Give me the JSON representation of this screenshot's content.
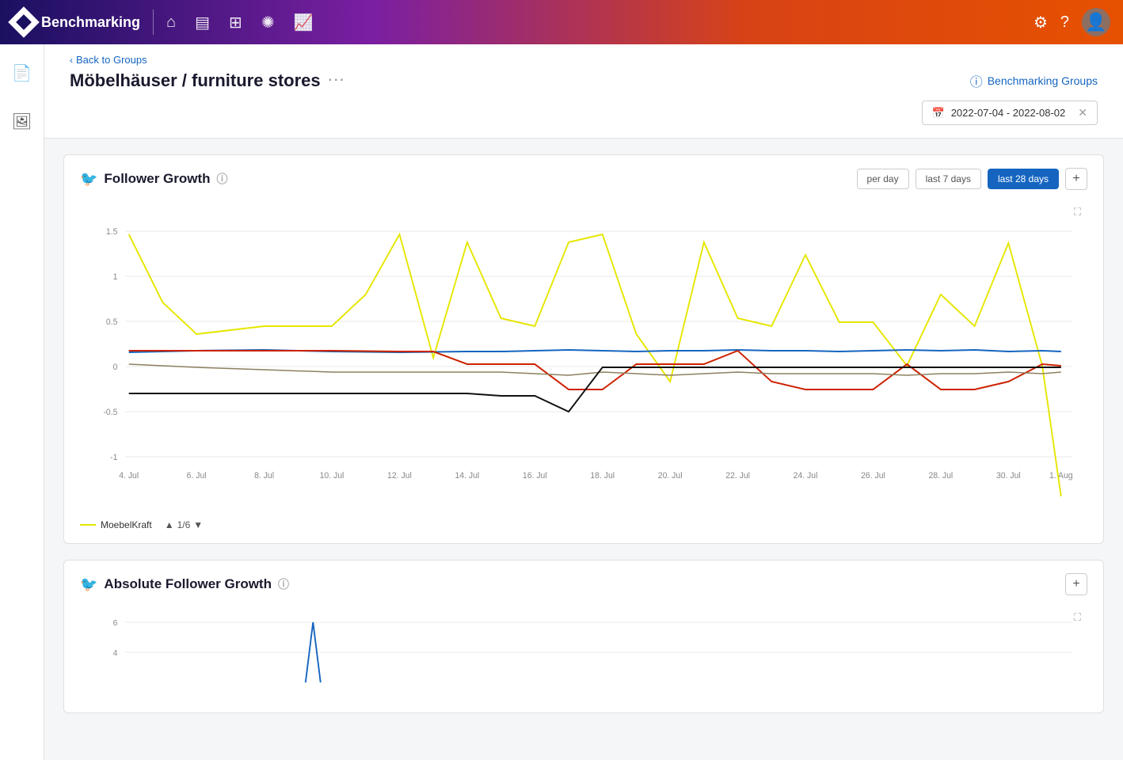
{
  "app": {
    "title": "Benchmarking"
  },
  "nav": {
    "icons": [
      "🏠",
      "📋",
      "🧮",
      "☀",
      "📈"
    ]
  },
  "sidebar": {
    "icons": [
      "📄",
      "🖼"
    ]
  },
  "breadcrumb": {
    "arrow": "‹",
    "label": "Back to Groups"
  },
  "page": {
    "title": "Möbelhäuser / furniture stores",
    "more": "···",
    "benchmarking_groups_label": "Benchmarking Groups",
    "date_range": "2022-07-04 - 2022-08-02"
  },
  "follower_growth_card": {
    "title": "Follower Growth",
    "btn_per_day": "per day",
    "btn_last7": "last 7 days",
    "btn_last28": "last 28 days",
    "x_labels": [
      "4. Jul",
      "6. Jul",
      "8. Jul",
      "10. Jul",
      "12. Jul",
      "14. Jul",
      "16. Jul",
      "18. Jul",
      "20. Jul",
      "22. Jul",
      "24. Jul",
      "26. Jul",
      "28. Jul",
      "30. Jul",
      "1. Aug"
    ],
    "y_labels": [
      "1.5",
      "1",
      "0.5",
      "0",
      "-0.5",
      "-1"
    ],
    "legend": [
      {
        "label": "MoebelKraft",
        "color": "#e6e600"
      }
    ],
    "legend_nav": "1/6"
  },
  "absolute_follower_card": {
    "title": "Absolute Follower Growth",
    "y_labels": [
      "6",
      "4"
    ]
  }
}
